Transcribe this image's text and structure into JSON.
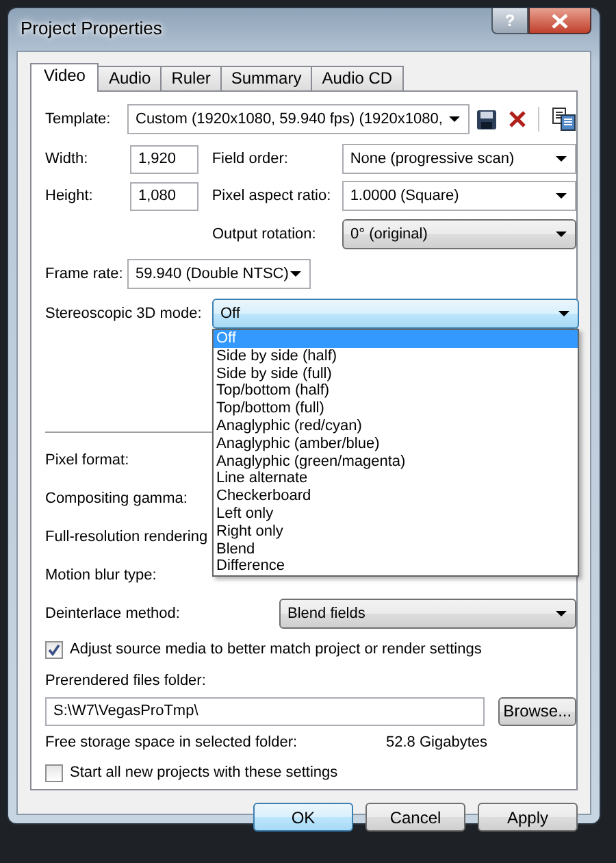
{
  "window": {
    "title": "Project Properties",
    "help_button": "?"
  },
  "tabs": [
    {
      "label": "Video",
      "selected": true
    },
    {
      "label": "Audio",
      "selected": false
    },
    {
      "label": "Ruler",
      "selected": false
    },
    {
      "label": "Summary",
      "selected": false
    },
    {
      "label": "Audio CD",
      "selected": false
    }
  ],
  "template": {
    "label": "Template:",
    "value": "Custom (1920x1080, 59.940 fps) (1920x1080,"
  },
  "width": {
    "label": "Width:",
    "value": "1,920"
  },
  "height": {
    "label": "Height:",
    "value": "1,080"
  },
  "field_order": {
    "label": "Field order:",
    "value": "None (progressive scan)"
  },
  "pixel_aspect_ratio": {
    "label": "Pixel aspect ratio:",
    "value": "1.0000 (Square)"
  },
  "output_rotation": {
    "label": "Output rotation:",
    "value": "0° (original)"
  },
  "frame_rate": {
    "label": "Frame rate:",
    "value": "59.940 (Double NTSC)"
  },
  "stereoscopic_3d_mode": {
    "label": "Stereoscopic 3D mode:",
    "value": "Off",
    "expanded": true,
    "options": [
      {
        "label": "Off",
        "selected": true
      },
      {
        "label": "Side by side (half)",
        "selected": false
      },
      {
        "label": "Side by side (full)",
        "selected": false
      },
      {
        "label": "Top/bottom (half)",
        "selected": false
      },
      {
        "label": "Top/bottom (full)",
        "selected": false
      },
      {
        "label": "Anaglyphic (red/cyan)",
        "selected": false
      },
      {
        "label": "Anaglyphic (amber/blue)",
        "selected": false
      },
      {
        "label": "Anaglyphic (green/magenta)",
        "selected": false
      },
      {
        "label": "Line alternate",
        "selected": false
      },
      {
        "label": "Checkerboard",
        "selected": false
      },
      {
        "label": "Left only",
        "selected": false
      },
      {
        "label": "Right only",
        "selected": false
      },
      {
        "label": "Blend",
        "selected": false
      },
      {
        "label": "Difference",
        "selected": false
      }
    ]
  },
  "hidden_settings": [
    {
      "label": "Pixel format:"
    },
    {
      "label": "Compositing gamma:"
    },
    {
      "label": "Full-resolution rendering"
    },
    {
      "label": "Motion blur type:"
    }
  ],
  "deinterlace_method": {
    "label": "Deinterlace method:",
    "value": "Blend fields"
  },
  "adjust_source_media": {
    "label": "Adjust source media to better match project or render settings",
    "checked": true
  },
  "prerendered_folder": {
    "label": "Prerendered files folder:",
    "value": "S:\\W7\\VegasProTmp\\",
    "browse": "Browse..."
  },
  "free_storage": {
    "label": "Free storage space in selected folder:",
    "value": "52.8 Gigabytes"
  },
  "start_all_new_projects": {
    "label": "Start all new projects with these settings",
    "checked": false
  },
  "buttons": [
    {
      "label": "OK",
      "default": true
    },
    {
      "label": "Cancel",
      "default": false
    },
    {
      "label": "Apply",
      "default": false
    }
  ]
}
